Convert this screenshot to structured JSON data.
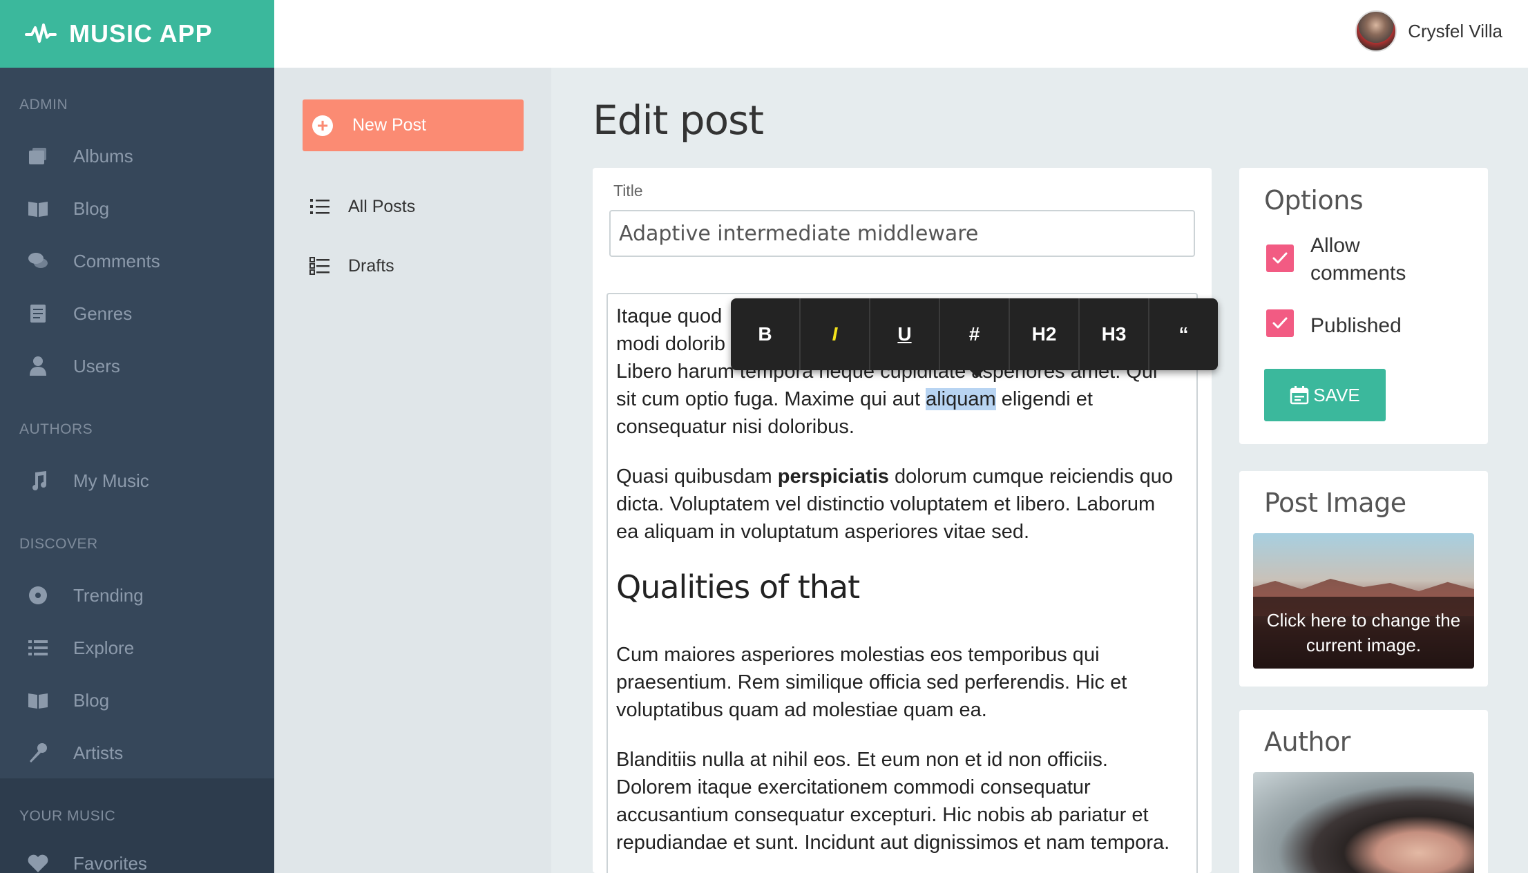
{
  "brand": {
    "name": "MUSIC APP"
  },
  "user": {
    "name": "Crysfel Villa"
  },
  "sidebar": {
    "sections": [
      {
        "heading": "ADMIN",
        "items": [
          "Albums",
          "Blog",
          "Comments",
          "Genres",
          "Users"
        ]
      },
      {
        "heading": "AUTHORS",
        "items": [
          "My Music"
        ]
      },
      {
        "heading": "DISCOVER",
        "items": [
          "Trending",
          "Explore",
          "Blog",
          "Artists"
        ]
      },
      {
        "heading": "YOUR MUSIC",
        "items": [
          "Favorites"
        ]
      }
    ]
  },
  "posts_nav": {
    "new_post": "New Post",
    "items": [
      "All Posts",
      "Drafts"
    ]
  },
  "page": {
    "title": "Edit post"
  },
  "editor": {
    "title_label": "Title",
    "title_value": "Adaptive intermediate middleware",
    "toolbar": [
      "B",
      "I",
      "U",
      "#",
      "H2",
      "H3",
      "“"
    ],
    "p1": {
      "a": "Itaque quod ",
      "b": "modi dolorib",
      "c": "Libero harum tempora neque cupiditate asperiores amet. Qui sit cum optio fuga. Maxime qui aut ",
      "highlight": "aliquam",
      "d": " eligendi et consequatur nisi doloribus."
    },
    "p2": {
      "a": "Quasi quibusdam ",
      "bold": "perspiciatis",
      "b": " dolorum cumque reiciendis quo dicta. Voluptatem vel distinctio voluptatem et libero. Laborum ea aliquam in voluptatum asperiores vitae sed."
    },
    "heading": "Qualities of that",
    "p3": "Cum maiores asperiores molestias eos temporibus qui praesentium. Rem similique officia sed perferendis. Hic et voluptatibus quam ad molestiae quam ea.",
    "p4": "Blanditiis nulla at nihil eos. Et eum non et id non officiis. Dolorem itaque exercitationem commodi consequatur accusantium consequatur excepturi. Hic nobis ab pariatur et repudiandae et sunt. Incidunt aut dignissimos et nam tempora."
  },
  "options": {
    "heading": "Options",
    "allow_comments_line1": "Allow",
    "allow_comments_line2": "comments",
    "allow_comments_checked": true,
    "published": "Published",
    "published_checked": true,
    "save": "SAVE"
  },
  "post_image": {
    "heading": "Post Image",
    "overlay": "Click here to change the current image."
  },
  "author": {
    "heading": "Author"
  },
  "colors": {
    "brand": "#3bb89c",
    "sidebar": "#36475a",
    "new_post": "#fb8b73",
    "checkbox": "#f25b83",
    "save": "#3bb89c"
  }
}
